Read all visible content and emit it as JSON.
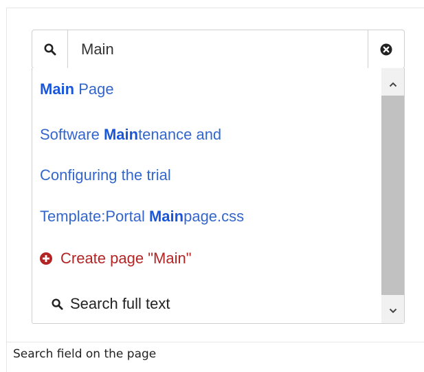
{
  "search": {
    "value": "Main",
    "icon": "search-icon",
    "clear_icon": "clear-icon"
  },
  "results": [
    {
      "bold": "Main",
      "rest": " Page",
      "prefix": ""
    },
    {
      "prefix": "Software ",
      "bold": "Main",
      "rest": "tenance and"
    },
    {
      "prefix": "Configuring the trial",
      "bold": "",
      "rest": ""
    },
    {
      "prefix": "Template:Portal ",
      "bold": "Main",
      "rest": "page.css"
    }
  ],
  "create_page": {
    "label": "Create page \"Main\"",
    "icon": "plus-circle-icon",
    "color": "#b32424"
  },
  "full_text": {
    "label": "Search full text",
    "icon": "search-icon"
  },
  "caption": "Search field on the page",
  "colors": {
    "link": "#3366cc",
    "link_bold": "#1a56d9",
    "border": "#cfcfcf"
  }
}
